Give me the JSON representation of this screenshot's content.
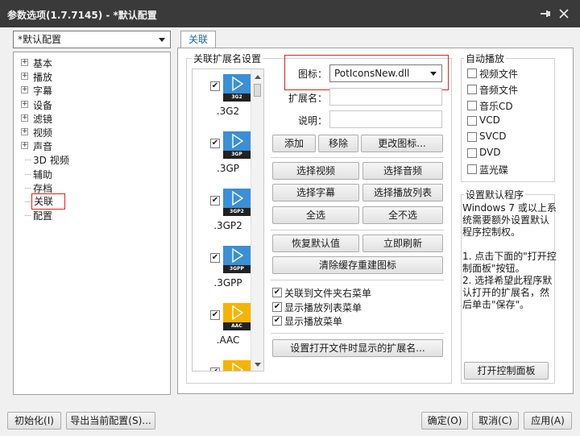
{
  "window": {
    "title": "参数选项(1.7.7145) - *默认配置"
  },
  "profile_selector": {
    "value": "*默认配置"
  },
  "sidebar": {
    "items": [
      {
        "label": "基本",
        "expandable": true
      },
      {
        "label": "播放",
        "expandable": true
      },
      {
        "label": "字幕",
        "expandable": true
      },
      {
        "label": "设备",
        "expandable": true
      },
      {
        "label": "滤镜",
        "expandable": true
      },
      {
        "label": "视频",
        "expandable": true
      },
      {
        "label": "声音",
        "expandable": true
      },
      {
        "label": "3D 视频",
        "expandable": false
      },
      {
        "label": "辅助",
        "expandable": false
      },
      {
        "label": "存档",
        "expandable": false
      },
      {
        "label": "关联",
        "expandable": false,
        "selected": true
      },
      {
        "label": "配置",
        "expandable": false
      }
    ]
  },
  "tab": {
    "label": "关联"
  },
  "ext_group": {
    "label": "关联扩展名设置",
    "items": [
      {
        "ext": ".3G2",
        "tag": "3G2",
        "checked": true,
        "color": "#3a8fd6"
      },
      {
        "ext": ".3GP",
        "tag": "3GP",
        "checked": true,
        "color": "#3a8fd6"
      },
      {
        "ext": ".3GP2",
        "tag": "3GP2",
        "checked": true,
        "color": "#3a8fd6"
      },
      {
        "ext": ".3GPP",
        "tag": "3GPP",
        "checked": true,
        "color": "#3a8fd6"
      },
      {
        "ext": ".AAC",
        "tag": "AAC",
        "checked": true,
        "color": "#f5b400"
      }
    ],
    "partial_item": {
      "checked": true,
      "color": "#f5b400"
    }
  },
  "fields": {
    "icon_label": "图标：",
    "icon_value": "PotIconsNew.dll",
    "ext_label": "扩展名：",
    "desc_label": "说明："
  },
  "buttons": {
    "add": "添加",
    "remove": "移除",
    "change_icon": "更改图标...",
    "select_video": "选择视频",
    "select_audio": "选择音频",
    "select_subtitle": "选择字幕",
    "select_playlist": "选择播放列表",
    "select_all": "全选",
    "select_none": "全不选",
    "restore_default": "恢复默认值",
    "refresh_now": "立即刷新",
    "clear_cache": "清除缓存重建图标",
    "set_open_ext": "设置打开文件时显示的扩展名...",
    "open_control_panel": "打开控制面板",
    "initialize": "初始化(I)",
    "export_config": "导出当前配置(S)...",
    "ok": "确定(O)",
    "cancel": "取消(C)",
    "apply": "应用(A)"
  },
  "checks": [
    {
      "label": "关联到文件夹右菜单",
      "checked": true
    },
    {
      "label": "显示播放列表菜单",
      "checked": true
    },
    {
      "label": "显示播放菜单",
      "checked": true
    }
  ],
  "autoplay": {
    "label": "自动播放",
    "items": [
      {
        "label": "视频文件",
        "checked": false
      },
      {
        "label": "音频文件",
        "checked": false
      },
      {
        "label": "音乐CD",
        "checked": false
      },
      {
        "label": "VCD",
        "checked": false
      },
      {
        "label": "SVCD",
        "checked": false
      },
      {
        "label": "DVD",
        "checked": false
      },
      {
        "label": "蓝光碟",
        "checked": false
      }
    ]
  },
  "default_program": {
    "label": "设置默认程序",
    "lines": [
      "Windows 7 或以上系",
      "统需要额外设置默认",
      "程序控制权。",
      "",
      "1. 点击下面的\"打开控",
      "制面板\"按钮。",
      "2. 选择希望此程序默",
      "认打开的扩展名，然",
      "后单击\"保存\"。"
    ]
  },
  "colors": {
    "titlebar": "#3a3a3a",
    "highlight": "#e02020",
    "check": "#1a1a1a"
  },
  "icons": [
    "pin-icon",
    "close-icon",
    "dropdown-arrow-icon",
    "tree-expander-icon",
    "play-file-icon",
    "scroll-up-icon",
    "scroll-down-icon"
  ]
}
